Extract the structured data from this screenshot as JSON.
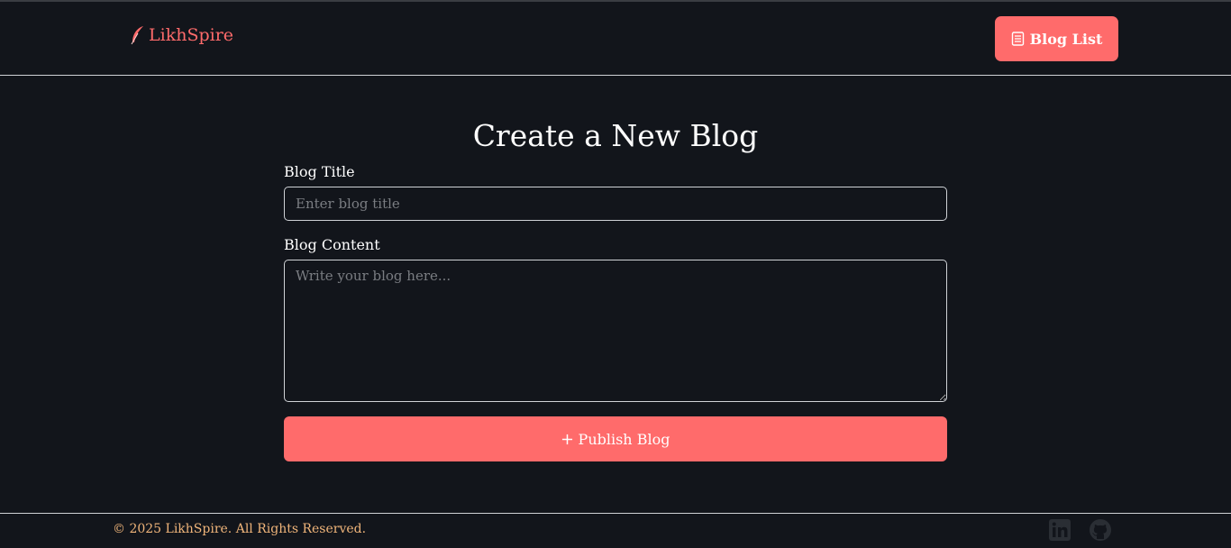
{
  "header": {
    "brand_name": "LikhSpire",
    "brand_icon": "feather-icon",
    "blog_list_label": "Blog List",
    "blog_list_icon": "list-icon"
  },
  "form": {
    "heading": "Create a New Blog",
    "title_label": "Blog Title",
    "title_placeholder": "Enter blog title",
    "title_value": "",
    "content_label": "Blog Content",
    "content_placeholder": "Write your blog here...",
    "content_value": "",
    "publish_label": "Publish Blog",
    "publish_icon": "plus-icon"
  },
  "footer": {
    "copyright": "© 2025 LikhSpire. All Rights Reserved.",
    "social": [
      "linkedin-icon",
      "github-icon"
    ]
  },
  "colors": {
    "background": "#12151b",
    "accent": "#ff6b6b",
    "footer_text": "#f0b57a",
    "border": "#cfd2d6",
    "social_icon": "#2a2e34"
  }
}
